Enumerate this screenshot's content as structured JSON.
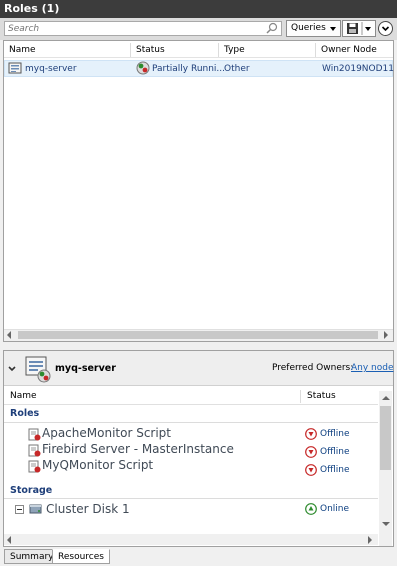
{
  "title_bar": {
    "text": "Roles (1)"
  },
  "toolbar": {
    "search_placeholder": "Search",
    "queries_label": "Queries"
  },
  "roles_table": {
    "columns": [
      "Name",
      "Status",
      "Type",
      "Owner Node"
    ],
    "rows": [
      {
        "name": "myq-server",
        "status": "Partially Runni...",
        "type": "Other",
        "owner": "Win2019NOD11"
      }
    ]
  },
  "details": {
    "name": "myq-server",
    "preferred_owners_label": "Preferred Owners:",
    "preferred_owners_link": "Any node",
    "columns": [
      "Name",
      "Status"
    ],
    "roles_heading": "Roles",
    "resources": [
      {
        "name": "ApacheMonitor Script",
        "status": "Offline"
      },
      {
        "name": "Firebird Server - MasterInstance",
        "status": "Offline"
      },
      {
        "name": "MyQMonitor Script",
        "status": "Offline"
      }
    ],
    "storage_heading": "Storage",
    "storage": [
      {
        "name": "Cluster Disk 1",
        "status": "Online"
      }
    ]
  },
  "tabs": [
    "Summary",
    "Resources"
  ],
  "colors": {
    "title_bar": "#3c3c3c",
    "selected_row": "#e5f1fb",
    "link": "#1a5fb4",
    "offline": "#c62828",
    "online": "#2e8b2e"
  }
}
